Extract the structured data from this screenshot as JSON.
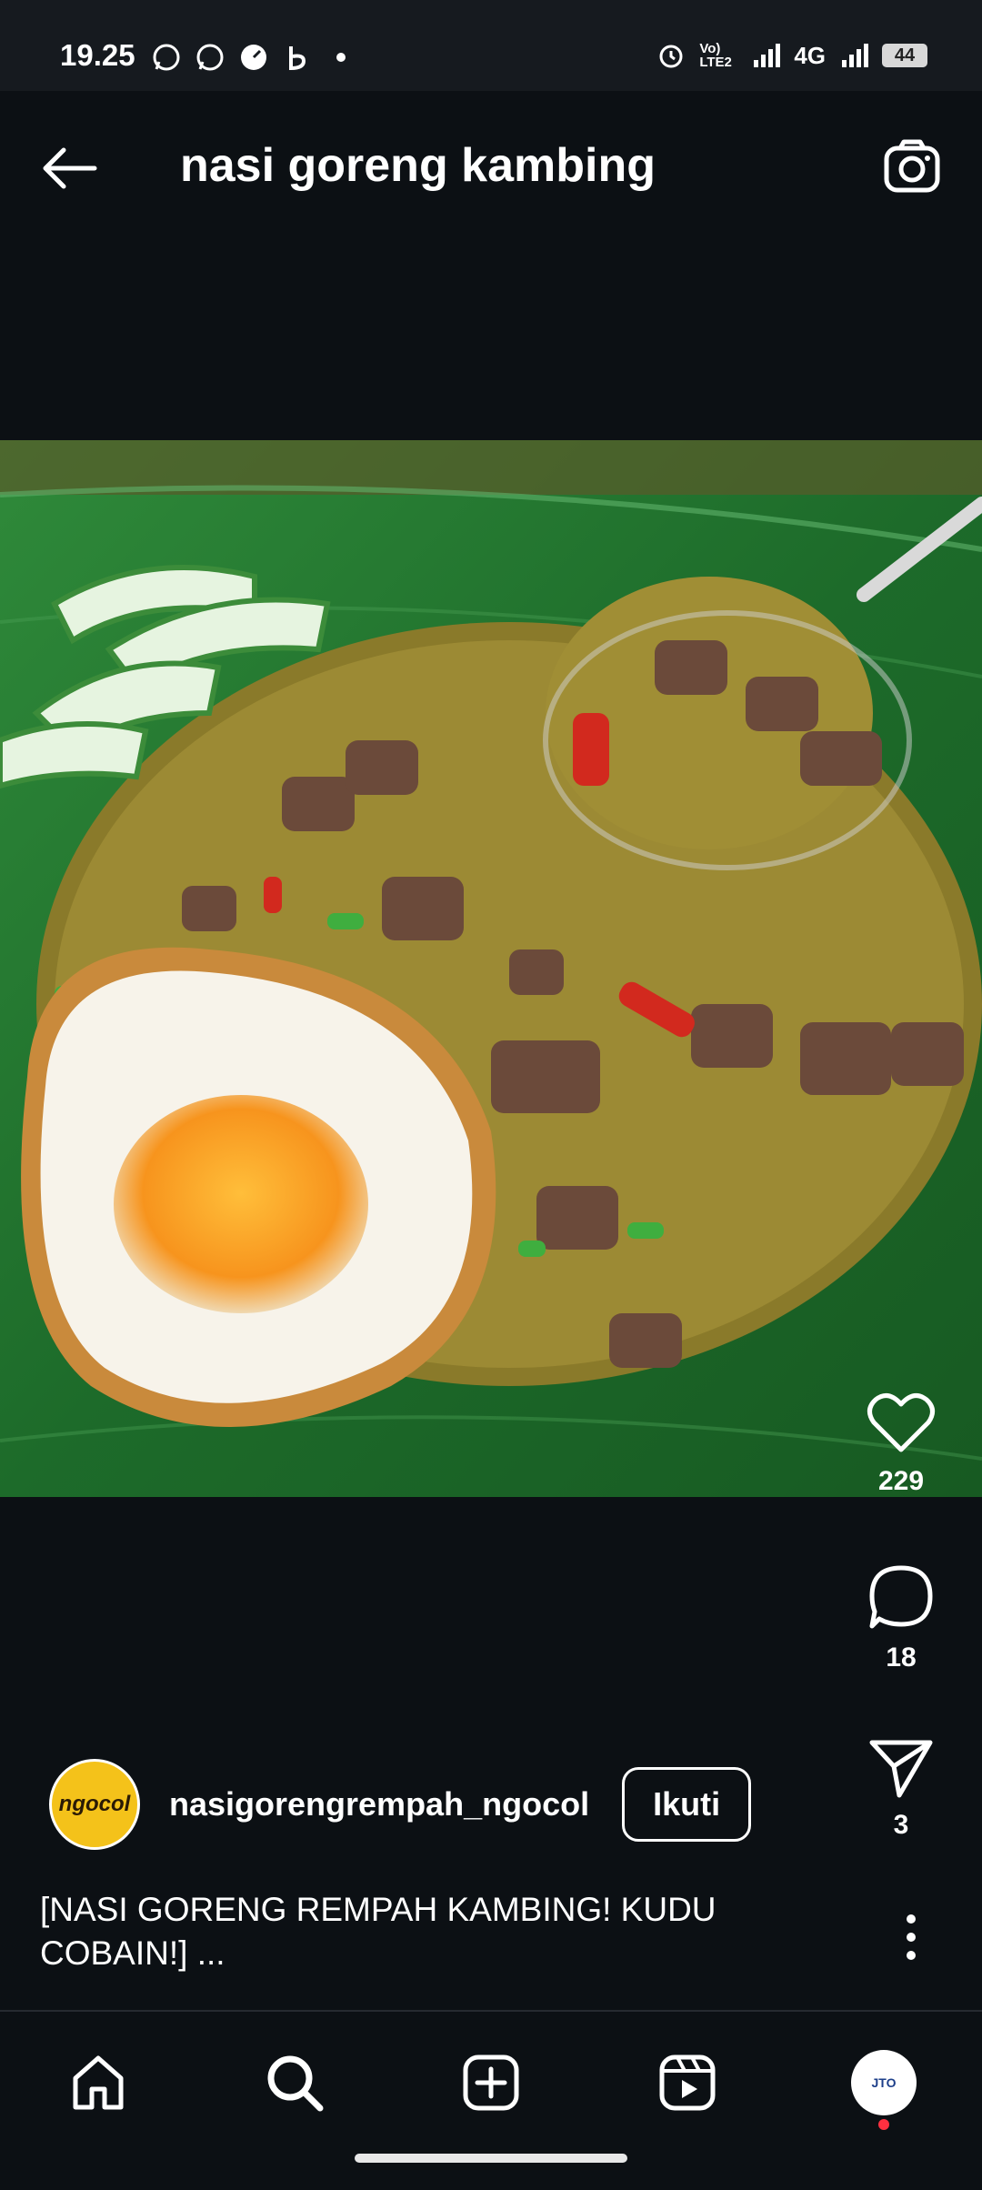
{
  "status_bar": {
    "time": "19.25",
    "network": "4G",
    "volte": "Vo) LTE2",
    "battery": "44",
    "icons": [
      "whatsapp-icon",
      "whatsapp-icon",
      "speedometer-icon",
      "b-icon",
      "dot-icon",
      "alarm-icon",
      "signal-icon",
      "wifi-signal-icon",
      "battery-icon"
    ]
  },
  "header": {
    "title": "nasi goreng kambing",
    "back_icon": "arrow-left-icon",
    "camera_icon": "camera-icon"
  },
  "post": {
    "actions": {
      "likes": "229",
      "comments": "18",
      "shares": "3"
    },
    "author": {
      "username": "nasigorengrempah_ngocol",
      "avatar_text": "ngocol",
      "follow_label": "Ikuti"
    },
    "caption": "[NASI GORENG REMPAH KAMBING! KUDU COBAIN!] ..."
  },
  "bottom_nav": {
    "items": [
      "home-icon",
      "search-icon",
      "create-icon",
      "reels-icon",
      "profile-avatar"
    ],
    "profile_avatar_text": "JTO"
  },
  "colors": {
    "background": "#0c1014",
    "text": "#ffffff",
    "notification": "#ff3040"
  }
}
